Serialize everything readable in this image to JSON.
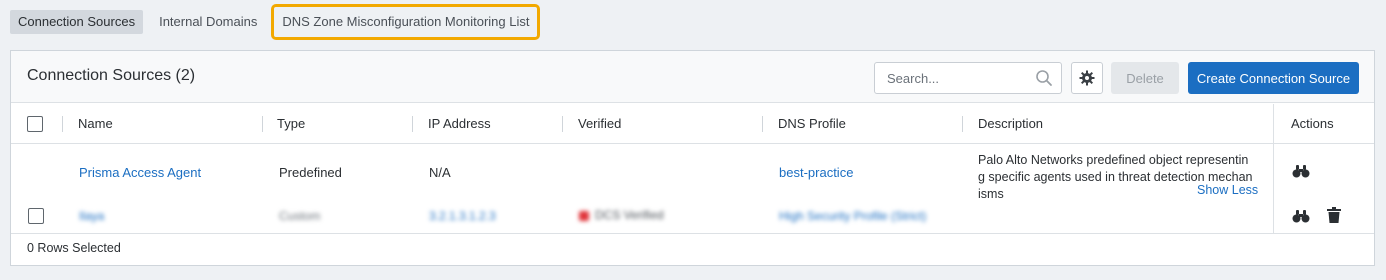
{
  "tabs": [
    {
      "label": "Connection Sources"
    },
    {
      "label": "Internal Domains"
    },
    {
      "label": "DNS Zone Misconfiguration Monitoring List"
    }
  ],
  "panel": {
    "title": "Connection Sources (2)",
    "search_placeholder": "Search...",
    "delete_label": "Delete",
    "create_label": "Create Connection Source"
  },
  "columns": [
    "Name",
    "Type",
    "IP Address",
    "Verified",
    "DNS Profile",
    "Description",
    "Actions"
  ],
  "rows": [
    {
      "name": "Prisma Access Agent",
      "type": "Predefined",
      "ip": "N/A",
      "verified": "",
      "dns_profile": "best-practice",
      "description": "Palo Alto Networks predefined object representing specific agents used in threat detection mechanisms",
      "show_less": "Show Less"
    },
    {
      "name": "Ilaya",
      "type": "Custom",
      "ip": "3.2.1.3.1.2.3",
      "verified": "DCS Verified",
      "dns_profile": "High Security Profile (Strict)"
    }
  ],
  "footer": {
    "rows_selected": "0 Rows Selected"
  },
  "colors": {
    "accent": "#1b6ec2",
    "highlight": "#f2a900",
    "error": "#e0353b"
  }
}
